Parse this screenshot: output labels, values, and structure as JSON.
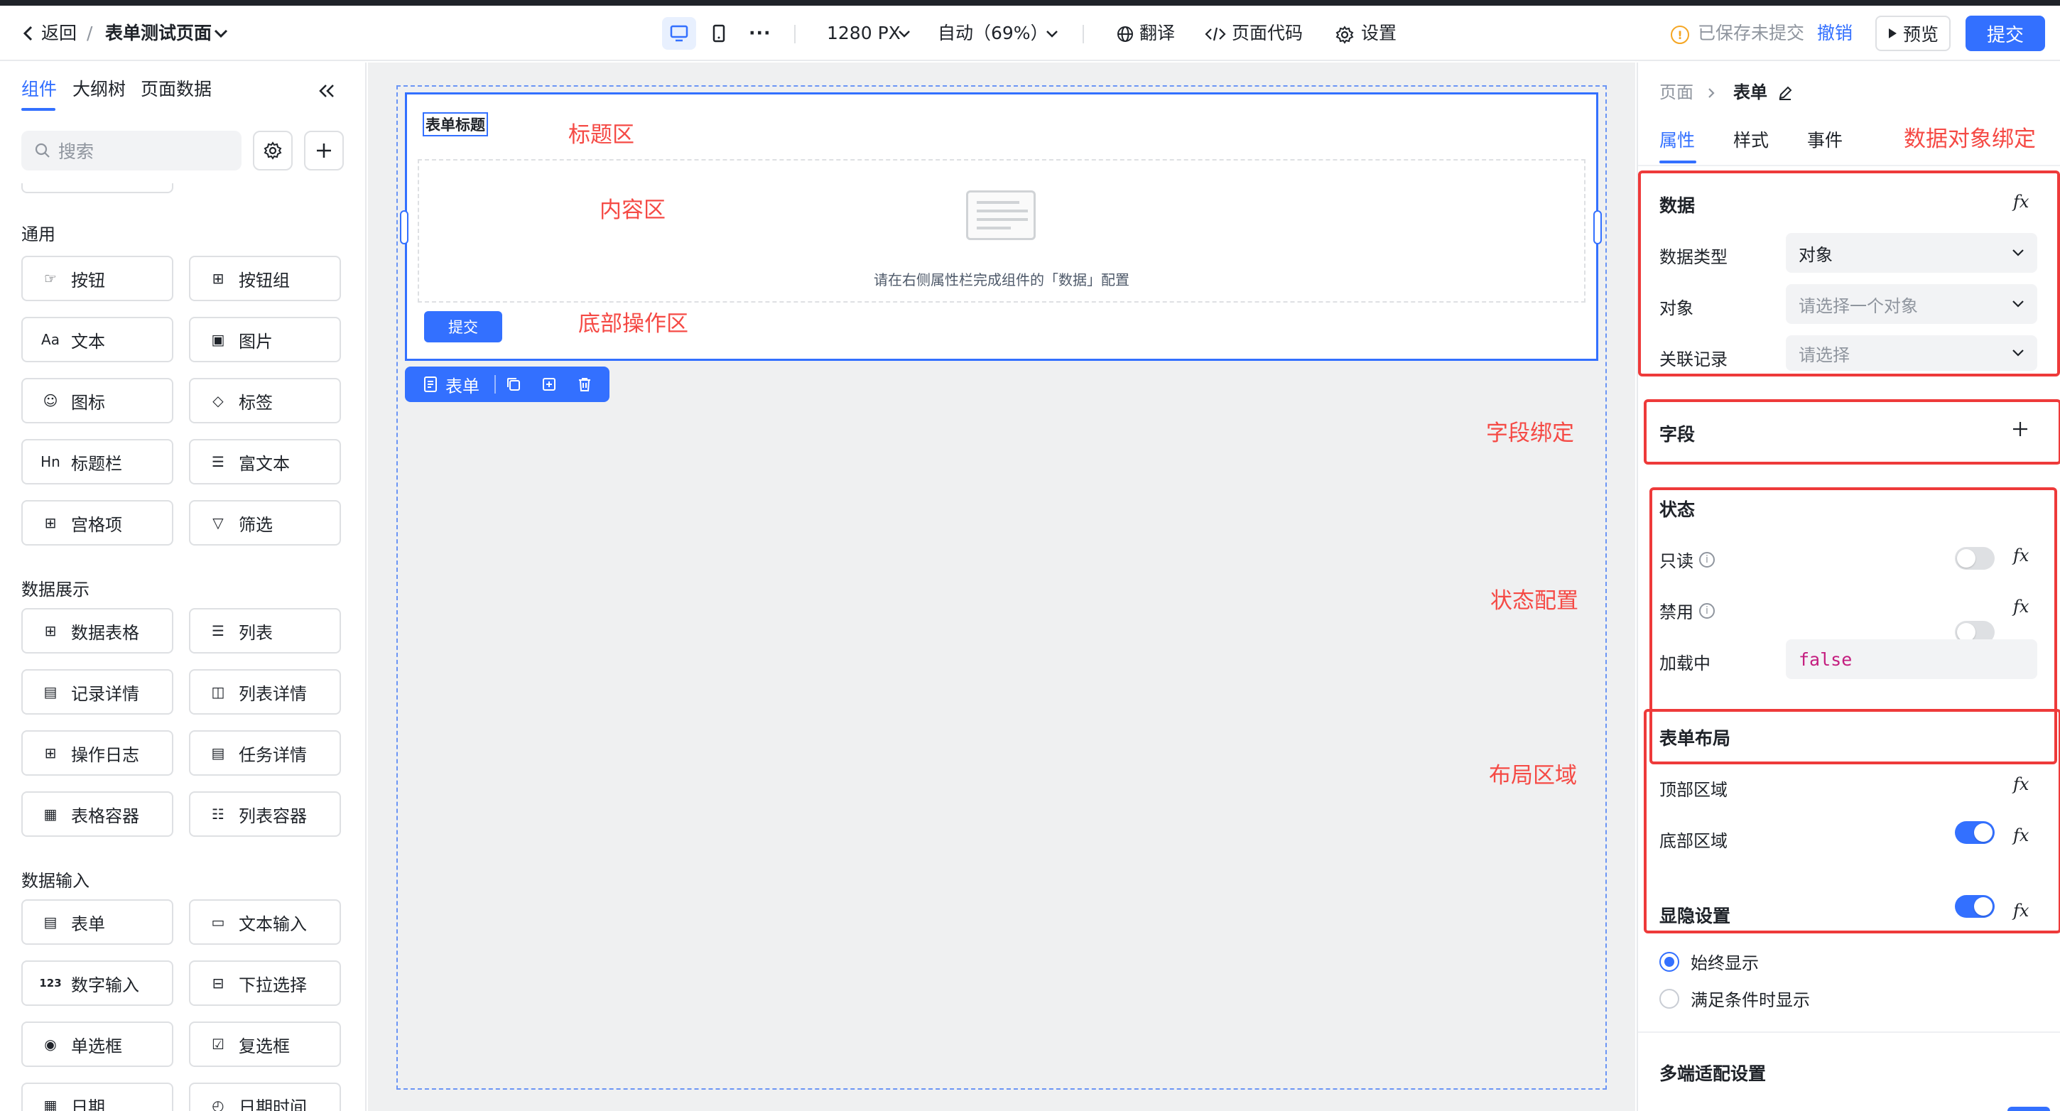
{
  "header": {
    "back_label": "返回",
    "separator": "/",
    "page_title": "表单测试页面",
    "width_value": "1280 PX",
    "zoom_label": "自动（69%）",
    "translate_label": "翻译",
    "page_code_label": "页面代码",
    "settings_label": "设置",
    "save_status": "已保存未提交",
    "undo_label": "撤销",
    "preview_label": "预览",
    "submit_label": "提交",
    "more_label": "···"
  },
  "left_panel": {
    "tabs": [
      {
        "label": "组件"
      },
      {
        "label": "大纲树"
      },
      {
        "label": "页面数据"
      }
    ],
    "search_placeholder": "搜索",
    "sections": [
      {
        "title": "通用",
        "items": [
          {
            "label": "按钮",
            "icon": "pointer-icon"
          },
          {
            "label": "按钮组",
            "icon": "button-group-icon"
          },
          {
            "label": "文本",
            "icon": "text-icon",
            "glyph": "Aa"
          },
          {
            "label": "图片",
            "icon": "image-icon"
          },
          {
            "label": "图标",
            "icon": "smile-icon"
          },
          {
            "label": "标签",
            "icon": "tag-icon"
          },
          {
            "label": "标题栏",
            "icon": "heading-icon",
            "glyph": "Hn"
          },
          {
            "label": "富文本",
            "icon": "rich-text-icon"
          },
          {
            "label": "宫格项",
            "icon": "grid-icon"
          },
          {
            "label": "筛选",
            "icon": "filter-icon"
          }
        ]
      },
      {
        "title": "数据展示",
        "items": [
          {
            "label": "数据表格",
            "icon": "table-icon"
          },
          {
            "label": "列表",
            "icon": "list-icon"
          },
          {
            "label": "记录详情",
            "icon": "record-detail-icon"
          },
          {
            "label": "列表详情",
            "icon": "list-detail-icon"
          },
          {
            "label": "操作日志",
            "icon": "log-icon"
          },
          {
            "label": "任务详情",
            "icon": "task-detail-icon"
          },
          {
            "label": "表格容器",
            "icon": "table-container-icon"
          },
          {
            "label": "列表容器",
            "icon": "list-container-icon"
          }
        ]
      },
      {
        "title": "数据输入",
        "items": [
          {
            "label": "表单",
            "icon": "form-icon"
          },
          {
            "label": "文本输入",
            "icon": "text-input-icon"
          },
          {
            "label": "数字输入",
            "icon": "number-input-icon",
            "glyph": "123"
          },
          {
            "label": "下拉选择",
            "icon": "dropdown-icon"
          },
          {
            "label": "单选框",
            "icon": "radio-icon"
          },
          {
            "label": "复选框",
            "icon": "checkbox-icon"
          },
          {
            "label": "日期",
            "icon": "date-icon"
          },
          {
            "label": "日期时间",
            "icon": "datetime-icon"
          }
        ]
      }
    ]
  },
  "canvas": {
    "form_title": "表单标题",
    "placeholder_text": "请在右侧属性栏完成组件的「数据」配置",
    "submit_button": "提交",
    "annotations": {
      "title_area": "标题区",
      "content_area": "内容区",
      "footer_area": "底部操作区",
      "field_binding": "字段绑定",
      "state_config": "状态配置",
      "layout_area": "布局区域",
      "data_object_binding": "数据对象绑定"
    },
    "floating_toolbar": {
      "label": "表单"
    }
  },
  "right_panel": {
    "breadcrumb": {
      "parent": "页面",
      "current": "表单"
    },
    "tabs": [
      {
        "label": "属性"
      },
      {
        "label": "样式"
      },
      {
        "label": "事件"
      }
    ],
    "data_section": {
      "title": "数据",
      "type_label": "数据类型",
      "type_value": "对象",
      "object_label": "对象",
      "object_placeholder": "请选择一个对象",
      "record_label": "关联记录",
      "record_placeholder": "请选择"
    },
    "fields_section": {
      "title": "字段"
    },
    "state_section": {
      "title": "状态",
      "readonly_label": "只读",
      "readonly_on": false,
      "disabled_label": "禁用",
      "disabled_on": false,
      "loading_label": "加载中",
      "loading_value": "false"
    },
    "layout_section": {
      "title": "表单布局",
      "top_label": "顶部区域",
      "top_on": true,
      "bottom_label": "底部区域",
      "bottom_on": true
    },
    "visibility_section": {
      "title": "显隐设置",
      "options": [
        {
          "label": "始终显示",
          "selected": true
        },
        {
          "label": "满足条件时显示",
          "selected": false
        }
      ]
    },
    "multi_device_section": {
      "title": "多端适配设置"
    },
    "fx_label": "fx"
  },
  "colors": {
    "accent": "#3370ff",
    "annotation_red": "#f54a45",
    "warning": "#f5a623"
  }
}
